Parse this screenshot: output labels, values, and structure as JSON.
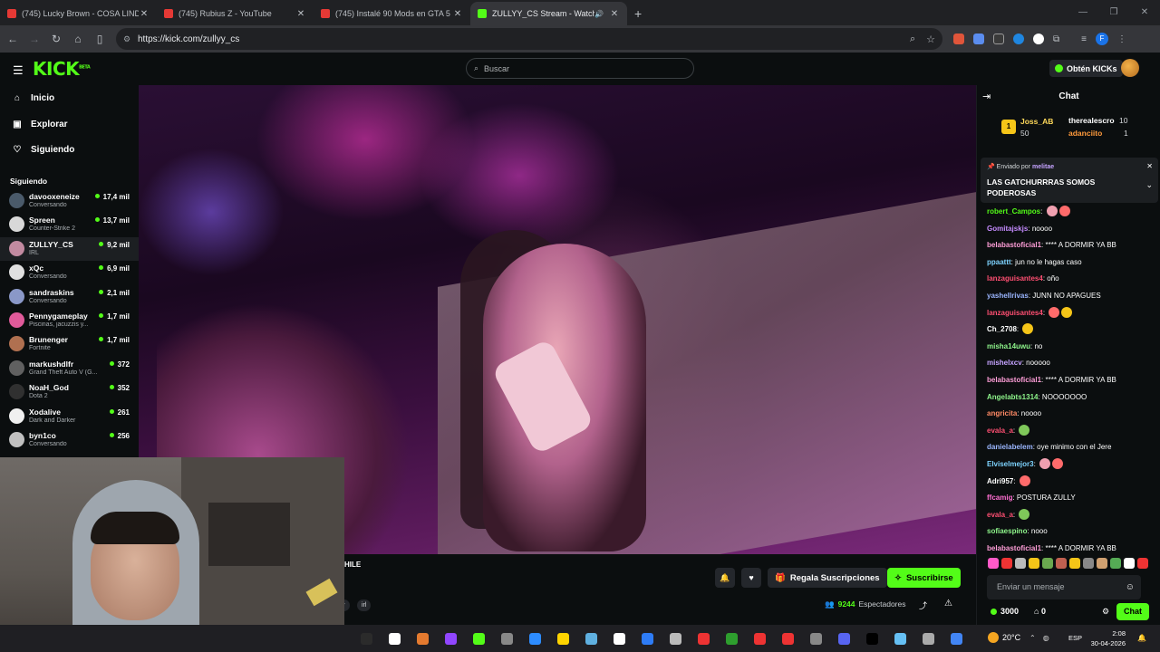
{
  "browser": {
    "tabs": [
      {
        "title": "(745) Lucky Brown - COSA LINDA",
        "close": "✕"
      },
      {
        "title": "(745) Rubius Z - YouTube",
        "close": "✕"
      },
      {
        "title": "(745) Instalé 90 Mods en GTA 5",
        "close": "✕"
      },
      {
        "title": "ZULLYY_CS Stream - Watch",
        "close": "✕",
        "active": true
      }
    ],
    "new_tab": "+",
    "url": "https://kick.com/zullyy_cs"
  },
  "header": {
    "logo": "KICK",
    "logo_badge": "BETA",
    "search_placeholder": "Buscar",
    "kicks_button": "Obtén KICKs"
  },
  "sidebar": {
    "nav": [
      {
        "label": "Inicio",
        "icon": "home-icon"
      },
      {
        "label": "Explorar",
        "icon": "compass-icon"
      },
      {
        "label": "Siguiendo",
        "icon": "heart-icon"
      }
    ],
    "following_title": "Siguiendo",
    "channels": [
      {
        "name": "davooxeneize",
        "sub": "Conversando",
        "viewers": "17,4 mil",
        "color": "#4a5a6a"
      },
      {
        "name": "Spreen",
        "sub": "Counter-Strike 2",
        "viewers": "13,7 mil",
        "color": "#d8d8d8"
      },
      {
        "name": "ZULLYY_CS",
        "sub": "IRL",
        "viewers": "9,2 mil",
        "color": "#c28aa0"
      },
      {
        "name": "xQc",
        "sub": "Conversando",
        "viewers": "6,9 mil",
        "color": "#e0e0e0"
      },
      {
        "name": "sandraskins",
        "sub": "Conversando",
        "viewers": "2,1 mil",
        "color": "#8a98c8"
      },
      {
        "name": "Pennygameplay",
        "sub": "Piscinas, jacuzzis y...",
        "viewers": "1,7 mil",
        "color": "#e05a9a"
      },
      {
        "name": "Brunenger",
        "sub": "Fortnite",
        "viewers": "1,7 mil",
        "color": "#b07050"
      },
      {
        "name": "markushdlfr",
        "sub": "Grand Theft Auto V (G...",
        "viewers": "372",
        "color": "#606060"
      },
      {
        "name": "NoaH_God",
        "sub": "Dota 2",
        "viewers": "352",
        "color": "#303030"
      },
      {
        "name": "Xodalive",
        "sub": "Dark and Darker",
        "viewers": "261",
        "color": "#f0f0f0"
      },
      {
        "name": "byn1co",
        "sub": "Conversando",
        "viewers": "256",
        "color": "#c0c0c0"
      }
    ]
  },
  "below_video": {
    "title_fragment": "HILE",
    "tags": [
      "y",
      "irl"
    ],
    "gift_label": "Regala Suscripciones",
    "subscribe_label": "Suscribirse",
    "viewers_count": "9244",
    "viewers_label": "Espectadores"
  },
  "chat": {
    "title": "Chat",
    "leaderboard": {
      "first": {
        "name": "Joss_AB",
        "amount": "50"
      },
      "second": {
        "name": "therealescro",
        "amount": "10"
      },
      "third": {
        "name": "adanciito",
        "amount": "1"
      }
    },
    "pinned": {
      "by_label": "Enviado por",
      "by_user": "melitae",
      "message": "LAS GATCHURRRAS SOMOS PODEROSAS"
    },
    "messages": [
      {
        "user": "robert_Campos",
        "text": "",
        "color": "#53fc18",
        "emotes": 2
      },
      {
        "user": "Gomitajskjs",
        "text": "noooo",
        "color": "#c58bff",
        "emotes": 0
      },
      {
        "user": "belabastoficial1",
        "text": "**** A DORMIR YA BB",
        "color": "#ff9ed8",
        "emotes": 0
      },
      {
        "user": "ppaattt",
        "text": "jun no le hagas caso",
        "color": "#7dd3ff",
        "emotes": 0
      },
      {
        "user": "lanzaguisantes4",
        "text": "oño",
        "color": "#ff4f72",
        "emotes": 0
      },
      {
        "user": "yashellrivas",
        "text": "JUNN NO APAGUES",
        "color": "#9bb6ff",
        "emotes": 0
      },
      {
        "user": "lanzaguisantes4",
        "text": "",
        "color": "#ff4f72",
        "emotes": 2
      },
      {
        "user": "Ch_2708",
        "text": "",
        "color": "#ffffff",
        "emotes": 1
      },
      {
        "user": "misha14uwu",
        "text": "no",
        "color": "#8ef58b",
        "emotes": 0
      },
      {
        "user": "mishelxcv",
        "text": "nooooo",
        "color": "#c5a3ff",
        "emotes": 0
      },
      {
        "user": "belabastoficial1",
        "text": "**** A DORMIR YA BB",
        "color": "#ff9ed8",
        "emotes": 0
      },
      {
        "user": "Angelabts1314",
        "text": "NOOOOOOO",
        "color": "#8ef58b",
        "emotes": 0
      },
      {
        "user": "angricita",
        "text": "noooo",
        "color": "#ff8a65",
        "emotes": 0
      },
      {
        "user": "evala_a",
        "text": "",
        "color": "#ff4f72",
        "emotes": 1
      },
      {
        "user": "danielabelem",
        "text": "oye minimo con el Jere",
        "color": "#9bb6ff",
        "emotes": 0
      },
      {
        "user": "Elviselmejor3",
        "text": "",
        "color": "#7dd3ff",
        "emotes": 2
      },
      {
        "user": "Adri957",
        "text": "",
        "color": "#ffffff",
        "emotes": 1
      },
      {
        "user": "ffcamig",
        "text": "POSTURA ZULLY",
        "color": "#ff6fd2",
        "emotes": 0
      },
      {
        "user": "evala_a",
        "text": "",
        "color": "#ff4f72",
        "emotes": 1
      },
      {
        "user": "sofiaespino",
        "text": "nooo",
        "color": "#8ef58b",
        "emotes": 0
      },
      {
        "user": "belabastoficial1",
        "text": "**** A DORMIR YA BB",
        "color": "#ff9ed8",
        "emotes": 0
      }
    ],
    "input_placeholder": "Enviar un mensaje",
    "kicks": "3000",
    "boxes": "0",
    "send_label": "Chat"
  },
  "taskbar": {
    "temperature": "20°C",
    "lang": "ESP",
    "time": "2:08",
    "date": "30-04-2026"
  },
  "colors": {
    "brand": "#53fc18",
    "bg": "#0b0e0f"
  }
}
